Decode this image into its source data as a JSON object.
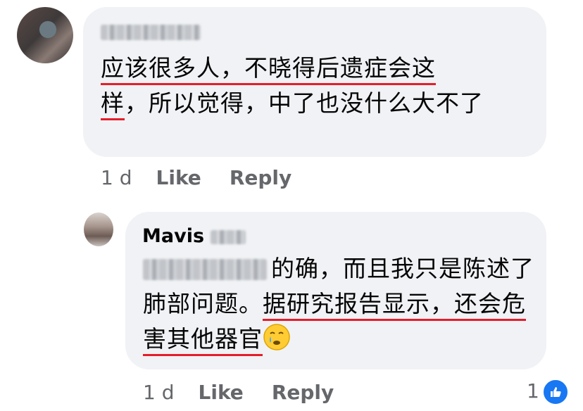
{
  "comment": {
    "text_part1_underlined": "应该很多人，不晓得后遗症会这",
    "text_part2_underlined": "样",
    "text_part3": "，所以觉得，中了也没什么大不了",
    "time": "1 d",
    "like_label": "Like",
    "reply_label": "Reply"
  },
  "reply": {
    "author_first": "Mavis",
    "text_part1": "的确，而且我只是陈述了肺部问题。",
    "text_part2_underlined": "据研究报告显示，还会危害其他器官",
    "emoji": "crying-face",
    "time": "1 d",
    "like_label": "Like",
    "reply_label": "Reply",
    "reaction_count": "1"
  },
  "colors": {
    "bubble": "#f0f2f5",
    "underline": "#e41e2a",
    "meta": "#65676b",
    "like_badge": "#1877f2"
  }
}
